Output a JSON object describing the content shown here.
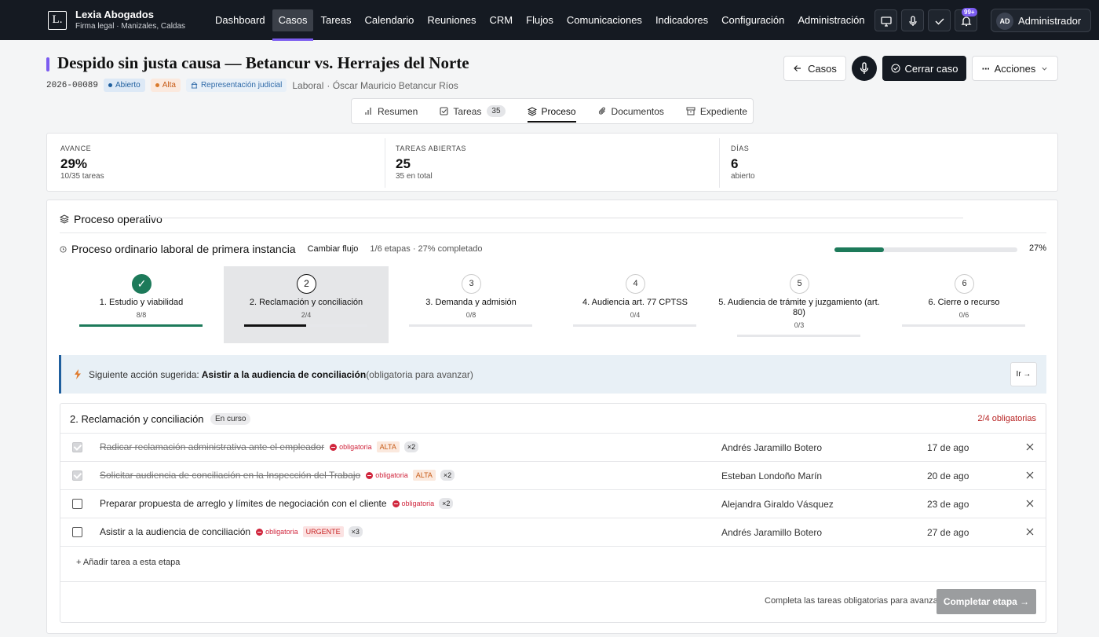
{
  "brand": {
    "logo_letter": "L.",
    "name": "Lexia Abogados",
    "subtitle": "Firma legal · Manizales, Caldas"
  },
  "nav": [
    "Dashboard",
    "Casos",
    "Tareas",
    "Calendario",
    "Reuniones",
    "CRM",
    "Flujos",
    "Comunicaciones",
    "Indicadores",
    "Configuración",
    "Administración"
  ],
  "nav_active": "Casos",
  "topbar": {
    "notification_badge": "99+",
    "user_initials": "AD",
    "user_name": "Administrador"
  },
  "case": {
    "title": "Despido sin justa causa — Betancur vs. Herrajes del Norte",
    "number": "2026-00089",
    "status": "Abierto",
    "priority": "Alta",
    "type": "Representación judicial",
    "area": "Laboral",
    "client": "· Óscar Mauricio Betancur Ríos"
  },
  "actions": {
    "back": "Casos",
    "close": "Cerrar caso",
    "more": "Acciones"
  },
  "tabs": [
    {
      "label": "Resumen"
    },
    {
      "label": "Tareas",
      "count": "35"
    },
    {
      "label": "Proceso"
    },
    {
      "label": "Documentos"
    },
    {
      "label": "Expediente"
    }
  ],
  "active_tab": "Proceso",
  "stats": [
    {
      "label": "AVANCE",
      "value": "29%",
      "sub": "10/35 tareas"
    },
    {
      "label": "TAREAS ABIERTAS",
      "value": "25",
      "sub": "35 en total"
    },
    {
      "label": "DÍAS",
      "value": "6",
      "sub": "abierto"
    }
  ],
  "process": {
    "heading": "Proceso operativo",
    "flow_name": "Proceso ordinario laboral de primera instancia",
    "change_flow": "Cambiar flujo",
    "meta": "1/6 etapas · 27% completado",
    "progress_pct": 27,
    "progress_label": "27%"
  },
  "stages": [
    {
      "num": "1",
      "name": "1. Estudio y viabilidad",
      "count": "8/8",
      "done": 8,
      "total": 8,
      "state": "done"
    },
    {
      "num": "2",
      "name": "2. Reclamación y conciliación",
      "count": "2/4",
      "done": 2,
      "total": 4,
      "state": "current"
    },
    {
      "num": "3",
      "name": "3. Demanda y admisión",
      "count": "0/8",
      "done": 0,
      "total": 8,
      "state": "pending"
    },
    {
      "num": "4",
      "name": "4. Audiencia art. 77 CPTSS",
      "count": "0/4",
      "done": 0,
      "total": 4,
      "state": "pending"
    },
    {
      "num": "5",
      "name": "5. Audiencia de trámite y juzgamiento (art. 80)",
      "count": "0/3",
      "done": 0,
      "total": 3,
      "state": "pending"
    },
    {
      "num": "6",
      "name": "6. Cierre o recurso",
      "count": "0/6",
      "done": 0,
      "total": 6,
      "state": "pending"
    }
  ],
  "suggestion": {
    "label": "Siguiente acción sugerida:",
    "title": "Asistir a la audiencia de conciliación",
    "note": "(obligatoria para avanzar)",
    "go": "Ir →"
  },
  "stage_detail": {
    "title": "2. Reclamación y conciliación",
    "chip": "En curso",
    "required": "2/4 obligatorias",
    "tasks": [
      {
        "name": "Radicar reclamación administrativa ante el empleador",
        "done": true,
        "required": "obligatoria",
        "priority": "ALTA",
        "mult": "×2",
        "assignee": "Andrés Jaramillo Botero",
        "date": "17 de ago"
      },
      {
        "name": "Solicitar audiencia de conciliación en la Inspección del Trabajo",
        "done": true,
        "required": "obligatoria",
        "priority": "ALTA",
        "mult": "×2",
        "assignee": "Esteban Londoño Marín",
        "date": "20 de ago"
      },
      {
        "name": "Preparar propuesta de arreglo y límites de negociación con el cliente",
        "done": false,
        "required": "obligatoria",
        "priority": "",
        "mult": "×2",
        "assignee": "Alejandra Giraldo Vásquez",
        "date": "23 de ago"
      },
      {
        "name": "Asistir a la audiencia de conciliación",
        "done": false,
        "required": "obligatoria",
        "priority": "URGENTE",
        "mult": "×3",
        "assignee": "Andrés Jaramillo Botero",
        "date": "27 de ago"
      }
    ],
    "add_task": "+ Añadir tarea a esta etapa",
    "footer_note": "Completa las tareas obligatorias para avanzar",
    "complete_btn": "Completar etapa →"
  },
  "colors": {
    "accent": "#7b5cf0",
    "success": "#1d7a5a",
    "danger": "#d0263d",
    "topbar": "#151a22"
  }
}
